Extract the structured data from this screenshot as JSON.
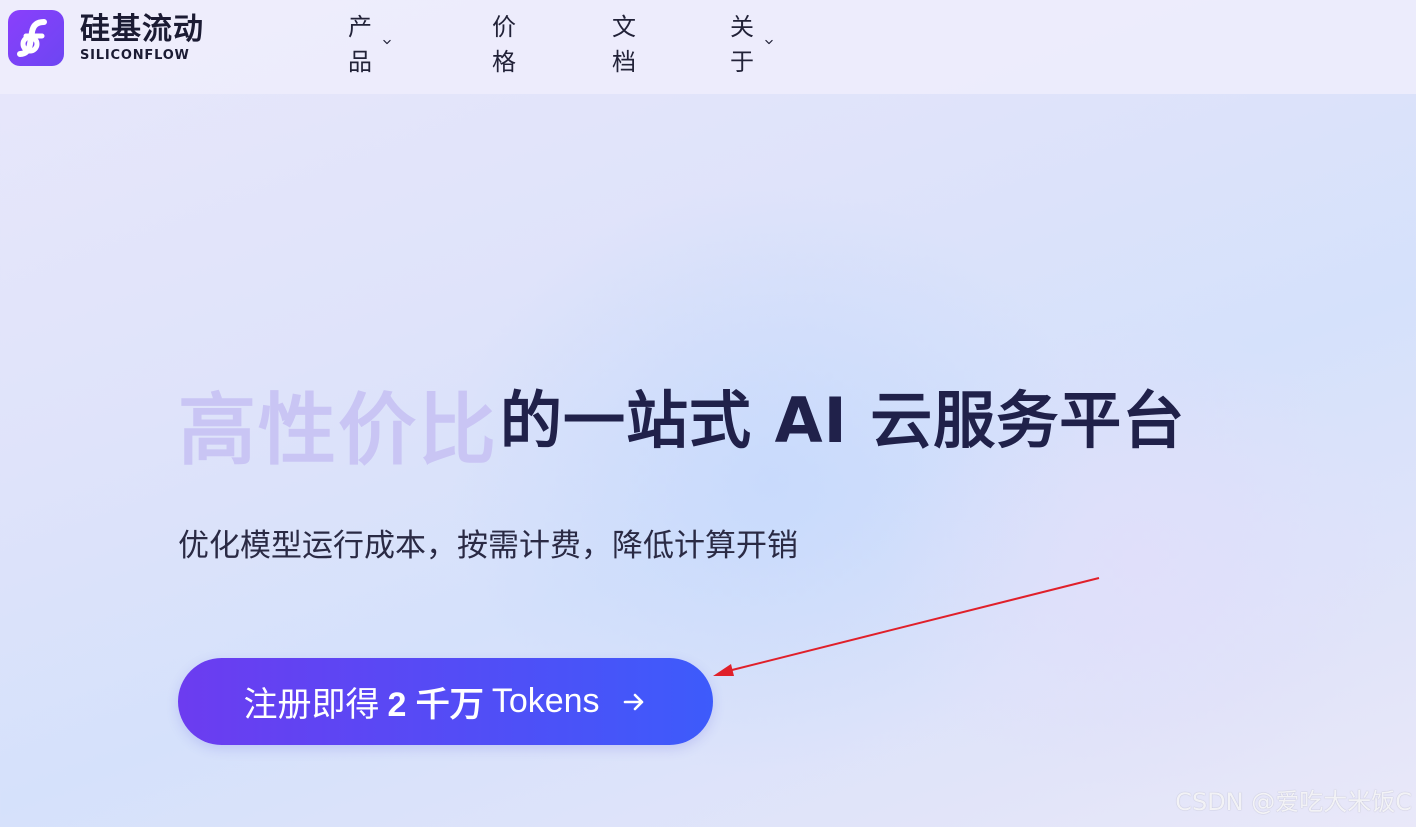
{
  "brand": {
    "name_cn": "硅基流动",
    "name_en": "SILICONFLOW",
    "logo_icon": "siliconflow-logo-icon",
    "accent_color": "#7b3ff7"
  },
  "nav": {
    "items": [
      {
        "label": "产品",
        "has_dropdown": true
      },
      {
        "label": "价格",
        "has_dropdown": false
      },
      {
        "label": "文档",
        "has_dropdown": false
      },
      {
        "label": "关于",
        "has_dropdown": true
      }
    ]
  },
  "hero": {
    "title_accent": "高性价比",
    "title_rest": "的一站式 AI 云服务平台",
    "subtitle": "优化模型运行成本，按需计费，降低计算开销"
  },
  "cta": {
    "prefix": "注册即得",
    "highlight": "2 千万",
    "suffix": "Tokens",
    "icon": "arrow-right-icon",
    "gradient_start": "#6c3cf0",
    "gradient_end": "#3d5bfb"
  },
  "annotation": {
    "color": "#e0202a"
  },
  "watermark": "CSDN @爱吃大米饭C"
}
